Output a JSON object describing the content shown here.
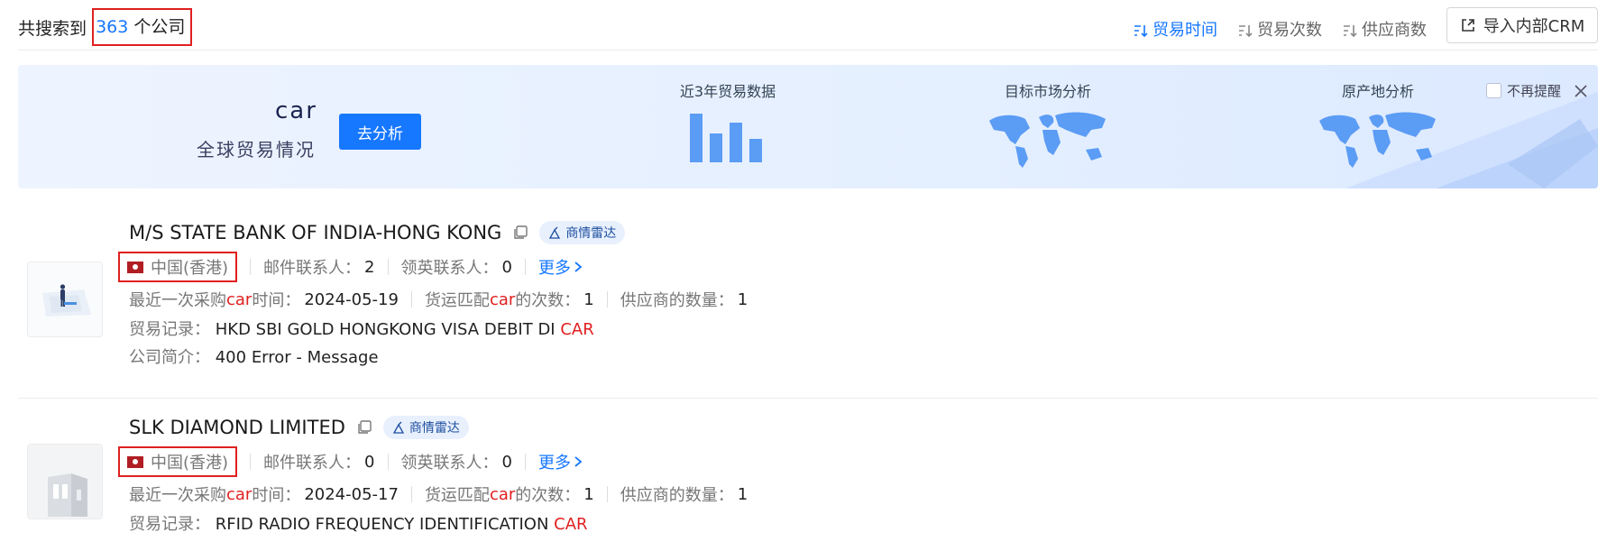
{
  "header": {
    "result_prefix": "共搜索到",
    "result_count": "363",
    "result_suffix": "个公司",
    "sort_options": [
      {
        "label": "贸易时间",
        "active": true
      },
      {
        "label": "贸易次数",
        "active": false
      },
      {
        "label": "供应商数",
        "active": false
      }
    ],
    "crm_button_label": "导入内部CRM"
  },
  "banner": {
    "keyword": "car",
    "subtitle": "全球贸易情况",
    "analyze_button": "去分析",
    "blocks": [
      {
        "label": "近3年贸易数据",
        "icon": "bar-chart-icon"
      },
      {
        "label": "目标市场分析",
        "icon": "world-map-icon"
      },
      {
        "label": "原产地分析",
        "icon": "world-map-icon"
      }
    ],
    "no_remind_label": "不再提醒"
  },
  "labels": {
    "mail_contacts": "邮件联系人：",
    "linkedin_contacts": "领英联系人：",
    "more": "更多",
    "last_purchase_prefix": "最近一次采购",
    "last_purchase_suffix": "时间：",
    "match_prefix": "货运匹配",
    "match_suffix": "的次数：",
    "supplier_count": "供应商的数量：",
    "trade_record": "贸易记录：",
    "company_intro": "公司简介：",
    "radar_tag": "商情雷达"
  },
  "companies": [
    {
      "name": "M/S STATE BANK OF INDIA-HONG KONG",
      "country": "中国(香港)",
      "mail_contacts": "2",
      "linkedin_contacts": "0",
      "keyword": "car",
      "last_purchase_date": "2024-05-19",
      "match_count": "1",
      "supplier_count": "1",
      "trade_record": "HKD SBI GOLD HONGKONG VISA DEBIT DI",
      "trade_keyword": "CAR",
      "intro": "400 Error - Message"
    },
    {
      "name": "SLK DIAMOND LIMITED",
      "country": "中国(香港)",
      "mail_contacts": "0",
      "linkedin_contacts": "0",
      "keyword": "car",
      "last_purchase_date": "2024-05-17",
      "match_count": "1",
      "supplier_count": "1",
      "trade_record": "RFID RADIO FREQUENCY IDENTIFICATION",
      "trade_keyword": "CAR"
    }
  ],
  "colors": {
    "accent": "#1677ff",
    "highlight_red": "#e02020",
    "banner_bg": "#e4efff"
  }
}
